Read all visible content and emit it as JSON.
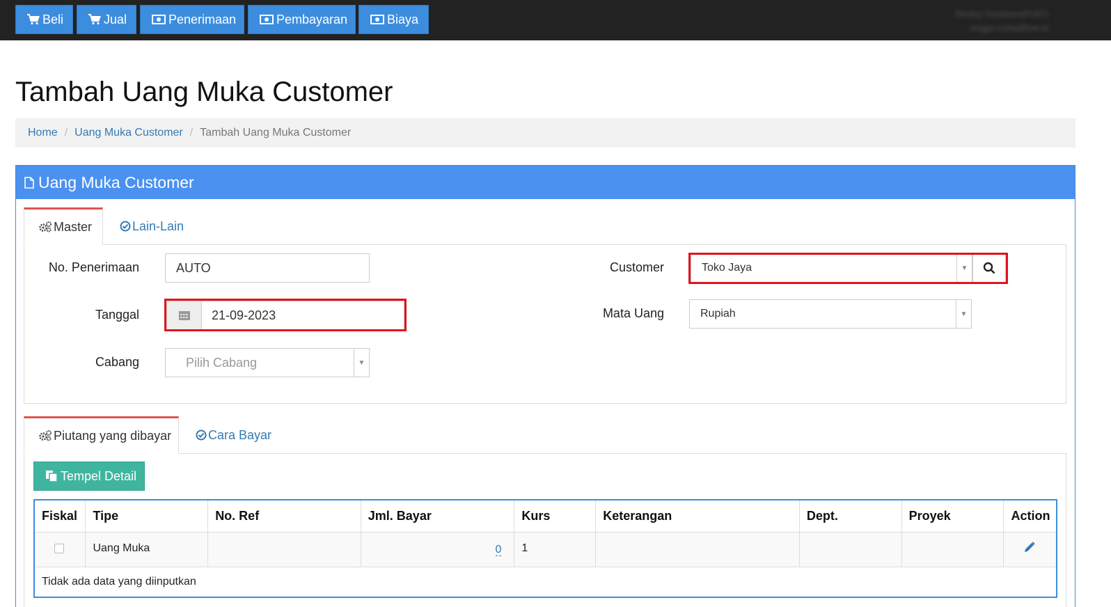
{
  "nav": {
    "buttons": [
      {
        "label": "Beli",
        "icon": "cart-icon"
      },
      {
        "label": "Jual",
        "icon": "cart-icon"
      },
      {
        "label": "Penerimaan",
        "icon": "money-icon"
      },
      {
        "label": "Pembayaran",
        "icon": "money-icon"
      },
      {
        "label": "Biaya",
        "icon": "money-icon"
      }
    ],
    "user_line1": "Shelley Danielsen(PLBT)",
    "user_line2": "angga.nurba@bee.id"
  },
  "page_title": "Tambah Uang Muka Customer",
  "breadcrumb": {
    "home": "Home",
    "parent": "Uang Muka Customer",
    "current": "Tambah Uang Muka Customer"
  },
  "panel": {
    "title": "Uang Muka Customer",
    "tabs": {
      "master": "Master",
      "lain": "Lain-Lain"
    }
  },
  "form": {
    "no_penerimaan_label": "No. Penerimaan",
    "no_penerimaan_value": "AUTO",
    "tanggal_label": "Tanggal",
    "tanggal_value": "21-09-2023",
    "cabang_label": "Cabang",
    "cabang_placeholder": "Pilih Cabang",
    "customer_label": "Customer",
    "customer_value": "Toko Jaya",
    "mata_uang_label": "Mata Uang",
    "mata_uang_value": "Rupiah"
  },
  "detail_tabs": {
    "piutang": "Piutang yang dibayar",
    "cara_bayar": "Cara Bayar"
  },
  "tempel_label": "Tempel Detail",
  "table": {
    "headers": [
      "Fiskal",
      "Tipe",
      "No. Ref",
      "Jml. Bayar",
      "Kurs",
      "Keterangan",
      "Dept.",
      "Proyek",
      "Action"
    ],
    "row": {
      "tipe": "Uang Muka",
      "no_ref": "",
      "jml_bayar": "0",
      "kurs": "1",
      "keterangan": "",
      "dept": "",
      "proyek": ""
    },
    "empty_text": "Tidak ada data yang diinputkan"
  },
  "colors": {
    "accent": "#4a91f0",
    "nav_btn": "#3c8dde",
    "highlight": "#e0141e",
    "teal": "#3fb5a0"
  }
}
